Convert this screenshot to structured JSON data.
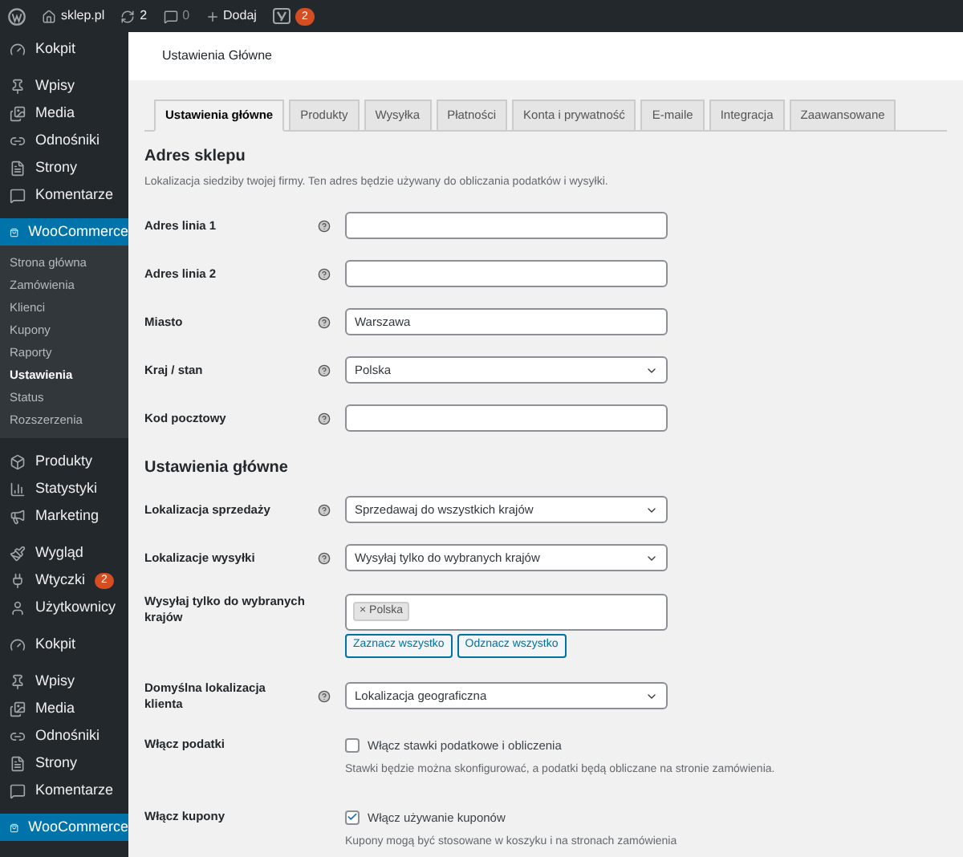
{
  "admin_bar": {
    "site": "sklep.pl",
    "updates": "2",
    "comments": "0",
    "new": "Dodaj",
    "seo_badge": "2"
  },
  "sidebar": {
    "groups": [
      [
        {
          "kind": "dashboard",
          "label": "Kokpit",
          "selected": false
        }
      ],
      [
        {
          "kind": "posts",
          "label": "Wpisy",
          "selected": false
        },
        {
          "kind": "media",
          "label": "Media",
          "selected": false
        },
        {
          "kind": "links",
          "label": "Odnośniki",
          "selected": false
        },
        {
          "kind": "pages",
          "label": "Strony",
          "selected": false
        },
        {
          "kind": "comments",
          "label": "Komentarze",
          "selected": false
        }
      ],
      [
        {
          "kind": "shop",
          "label": "WooCommerce",
          "selected": true,
          "children": [
            {
              "label": "Strona główna",
              "selected": false
            },
            {
              "label": "Zamówienia",
              "selected": false
            },
            {
              "label": "Klienci",
              "selected": false
            },
            {
              "label": "Kupony",
              "selected": false
            },
            {
              "label": "Raporty",
              "selected": false
            },
            {
              "label": "Ustawienia",
              "selected": true
            },
            {
              "label": "Status",
              "selected": false
            },
            {
              "label": "Rozszerzenia",
              "selected": false
            }
          ]
        }
      ],
      [
        {
          "kind": "products",
          "label": "Produkty",
          "selected": false
        },
        {
          "kind": "stats",
          "label": "Statystyki",
          "selected": false
        },
        {
          "kind": "marketing",
          "label": "Marketing",
          "selected": false
        }
      ],
      [
        {
          "kind": "appearance",
          "label": "Wygląd",
          "selected": false
        },
        {
          "kind": "plugins",
          "label": "Wtyczki",
          "selected": false,
          "badge": "2"
        },
        {
          "kind": "users",
          "label": "Użytkownicy",
          "selected": false
        }
      ],
      [
        {
          "kind": "dashboard",
          "label": "Kokpit",
          "selected": false
        }
      ],
      [
        {
          "kind": "posts",
          "label": "Wpisy",
          "selected": false
        },
        {
          "kind": "media",
          "label": "Media",
          "selected": false
        },
        {
          "kind": "links",
          "label": "Odnośniki",
          "selected": false
        },
        {
          "kind": "pages",
          "label": "Strony",
          "selected": false
        },
        {
          "kind": "comments",
          "label": "Komentarze",
          "selected": false
        }
      ],
      [
        {
          "kind": "shop",
          "label": "WooCommerce",
          "selected": true
        }
      ]
    ]
  },
  "page_title": "Ustawienia Główne",
  "tabs": [
    {
      "label": "Ustawienia główne",
      "selected": true
    },
    {
      "label": "Produkty",
      "selected": false
    },
    {
      "label": "Wysyłka",
      "selected": false
    },
    {
      "label": "Płatności",
      "selected": false
    },
    {
      "label": "Konta i prywatność",
      "selected": false
    },
    {
      "label": "E-maile",
      "selected": false
    },
    {
      "label": "Integracja",
      "selected": false
    },
    {
      "label": "Zaawansowane",
      "selected": false
    }
  ],
  "sections": [
    {
      "title": "Adres sklepu",
      "description": "Lokalizacja siedziby twojej firmy. Ten adres będzie używany do obliczania podatków i wysyłki.",
      "fields": [
        {
          "kind": "text",
          "label": "Adres linia 1",
          "help": true
        },
        {
          "kind": "text",
          "label": "Adres linia 2",
          "help": true
        },
        {
          "kind": "text",
          "label": "Miasto",
          "help": true,
          "value": "Warszawa"
        },
        {
          "kind": "select",
          "label": "Kraj / stan",
          "help": true,
          "value": "Polska"
        },
        {
          "kind": "text",
          "label": "Kod pocztowy",
          "help": true
        }
      ]
    },
    {
      "title": "Ustawienia główne",
      "fields": [
        {
          "kind": "select",
          "label": "Lokalizacja sprzedaży",
          "help": true,
          "value": "Sprzedawaj do wszystkich krajów"
        },
        {
          "kind": "select",
          "label": "Lokalizacje wysyłki",
          "help": true,
          "value": "Wysyłaj tylko do wybranych krajów"
        },
        {
          "kind": "multiselect",
          "label": "Wysyłaj tylko do wybranych krajów",
          "help": false,
          "tags": [
            "× Polska"
          ],
          "buttons": [
            "Zaznacz wszystko",
            "Odznacz wszystko"
          ]
        },
        {
          "kind": "select",
          "label": "Domyślna lokalizacja klienta",
          "help": true,
          "value": "Lokalizacja geograficzna"
        },
        {
          "kind": "checkbox",
          "label": "Włącz podatki",
          "help": false,
          "checked": false,
          "option": "Włącz stawki podatkowe i obliczenia",
          "description": "Stawki będzie można skonfigurować, a podatki będą obliczane na stronie zamówienia."
        },
        {
          "kind": "checkbox",
          "label": "Włącz kupony",
          "help": false,
          "checked": true,
          "option": "Włącz używanie kuponów",
          "description": "Kupony mogą być stosowane w koszyku i na stronach zamówienia"
        }
      ]
    }
  ]
}
